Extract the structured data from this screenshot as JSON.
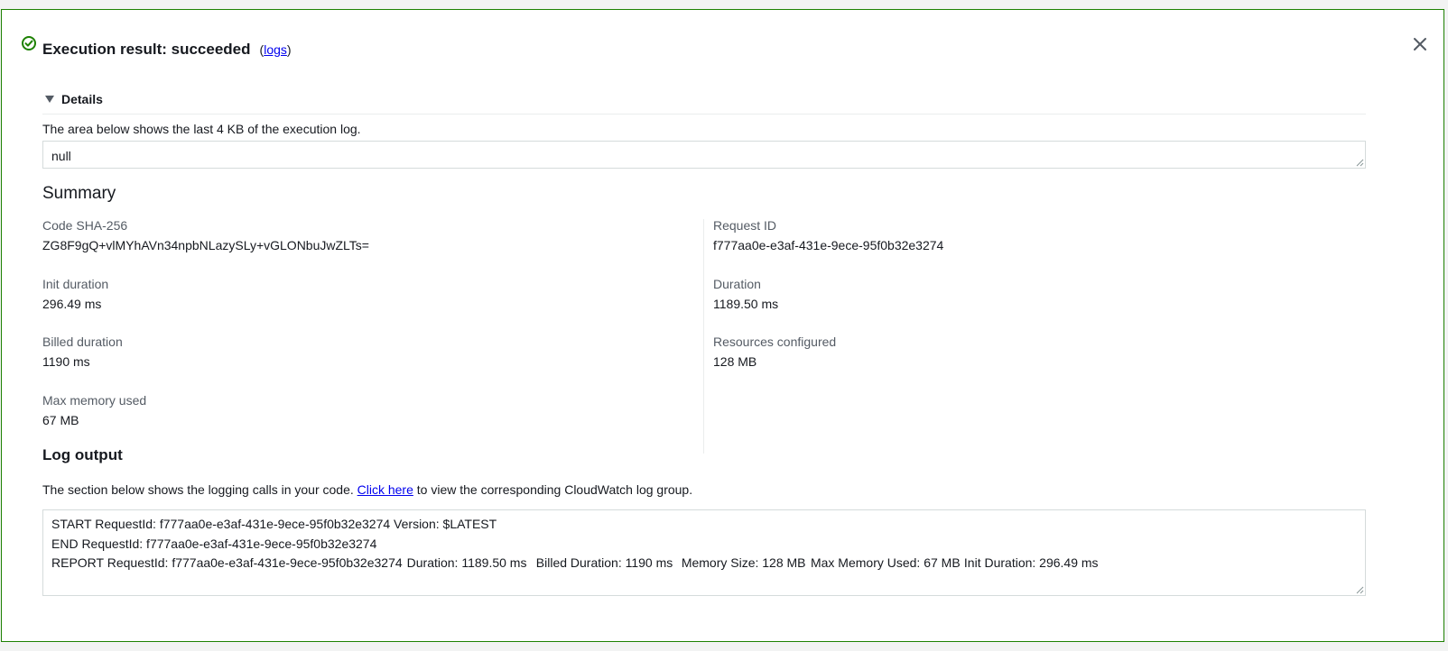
{
  "header": {
    "title": "Execution result: succeeded",
    "logs_open": "(",
    "logs_link": "logs",
    "logs_close": ")"
  },
  "details": {
    "toggle_label": "Details",
    "description": "The area below shows the last 4 KB of the execution log.",
    "output_value": "null"
  },
  "summary": {
    "title": "Summary",
    "left": [
      {
        "label": "Code SHA-256",
        "value": "ZG8F9gQ+vlMYhAVn34npbNLazySLy+vGLONbuJwZLTs="
      },
      {
        "label": "Init duration",
        "value": "296.49 ms"
      },
      {
        "label": "Billed duration",
        "value": "1190 ms"
      },
      {
        "label": "Max memory used",
        "value": "67 MB"
      }
    ],
    "right": [
      {
        "label": "Request ID",
        "value": "f777aa0e-e3af-431e-9ece-95f0b32e3274"
      },
      {
        "label": "Duration",
        "value": "1189.50 ms"
      },
      {
        "label": "Resources configured",
        "value": "128 MB"
      }
    ]
  },
  "log_output": {
    "title": "Log output",
    "desc_before": "The section below shows the logging calls in your code.",
    "link": "Click here",
    "desc_after": "to view the corresponding CloudWatch log group.",
    "lines": [
      "START RequestId: f777aa0e-e3af-431e-9ece-95f0b32e3274 Version: $LATEST",
      "END RequestId: f777aa0e-e3af-431e-9ece-95f0b32e3274",
      "REPORT RequestId: f777aa0e-e3af-431e-9ece-95f0b32e3274\tDuration: 1189.50 ms\tBilled Duration: 1190 ms\tMemory Size: 128 MB\tMax Memory Used: 67 MB\tInit Duration: 296.49 ms\t"
    ]
  },
  "colors": {
    "success": "#1d8102",
    "link": "#0000ee",
    "label": "#545b64",
    "text": "#16191f"
  },
  "icons": {
    "status": "check-circle-icon",
    "close": "close-icon",
    "toggle": "caret-down-icon"
  }
}
